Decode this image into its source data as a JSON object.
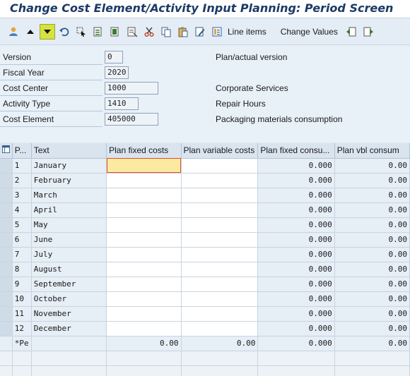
{
  "title": "Change Cost Element/Activity Input Planning: Period Screen",
  "toolbar": {
    "line_items_label": "Line items",
    "change_values_label": "Change Values"
  },
  "header": {
    "version": {
      "label": "Version",
      "value": "0",
      "desc": "Plan/actual version"
    },
    "fiscal_year": {
      "label": "Fiscal Year",
      "value": "2020",
      "desc": ""
    },
    "cost_center": {
      "label": "Cost Center",
      "value": "1000",
      "desc": "Corporate Services"
    },
    "activity_type": {
      "label": "Activity Type",
      "value": "1410",
      "desc": "Repair Hours"
    },
    "cost_element": {
      "label": "Cost Element",
      "value": "405000",
      "desc": "Packaging materials consumption"
    }
  },
  "table": {
    "columns": [
      "P...",
      "Text",
      "Plan fixed costs",
      "Plan variable costs",
      "Plan fixed consu...",
      "Plan vbl consum"
    ],
    "rows": [
      {
        "period": "1",
        "text": "January",
        "fixed": "",
        "variable": "",
        "fixed_cons": "0.000",
        "vbl_cons": "0.00"
      },
      {
        "period": "2",
        "text": "February",
        "fixed": "",
        "variable": "",
        "fixed_cons": "0.000",
        "vbl_cons": "0.00"
      },
      {
        "period": "3",
        "text": "March",
        "fixed": "",
        "variable": "",
        "fixed_cons": "0.000",
        "vbl_cons": "0.00"
      },
      {
        "period": "4",
        "text": "April",
        "fixed": "",
        "variable": "",
        "fixed_cons": "0.000",
        "vbl_cons": "0.00"
      },
      {
        "period": "5",
        "text": "May",
        "fixed": "",
        "variable": "",
        "fixed_cons": "0.000",
        "vbl_cons": "0.00"
      },
      {
        "period": "6",
        "text": "June",
        "fixed": "",
        "variable": "",
        "fixed_cons": "0.000",
        "vbl_cons": "0.00"
      },
      {
        "period": "7",
        "text": "July",
        "fixed": "",
        "variable": "",
        "fixed_cons": "0.000",
        "vbl_cons": "0.00"
      },
      {
        "period": "8",
        "text": "August",
        "fixed": "",
        "variable": "",
        "fixed_cons": "0.000",
        "vbl_cons": "0.00"
      },
      {
        "period": "9",
        "text": "September",
        "fixed": "",
        "variable": "",
        "fixed_cons": "0.000",
        "vbl_cons": "0.00"
      },
      {
        "period": "10",
        "text": "October",
        "fixed": "",
        "variable": "",
        "fixed_cons": "0.000",
        "vbl_cons": "0.00"
      },
      {
        "period": "11",
        "text": "November",
        "fixed": "",
        "variable": "",
        "fixed_cons": "0.000",
        "vbl_cons": "0.00"
      },
      {
        "period": "12",
        "text": "December",
        "fixed": "",
        "variable": "",
        "fixed_cons": "0.000",
        "vbl_cons": "0.00"
      }
    ],
    "total": {
      "period": "*Pe",
      "text": "",
      "fixed": "0.00",
      "variable": "0.00",
      "fixed_cons": "0.000",
      "vbl_cons": "0.00"
    }
  }
}
